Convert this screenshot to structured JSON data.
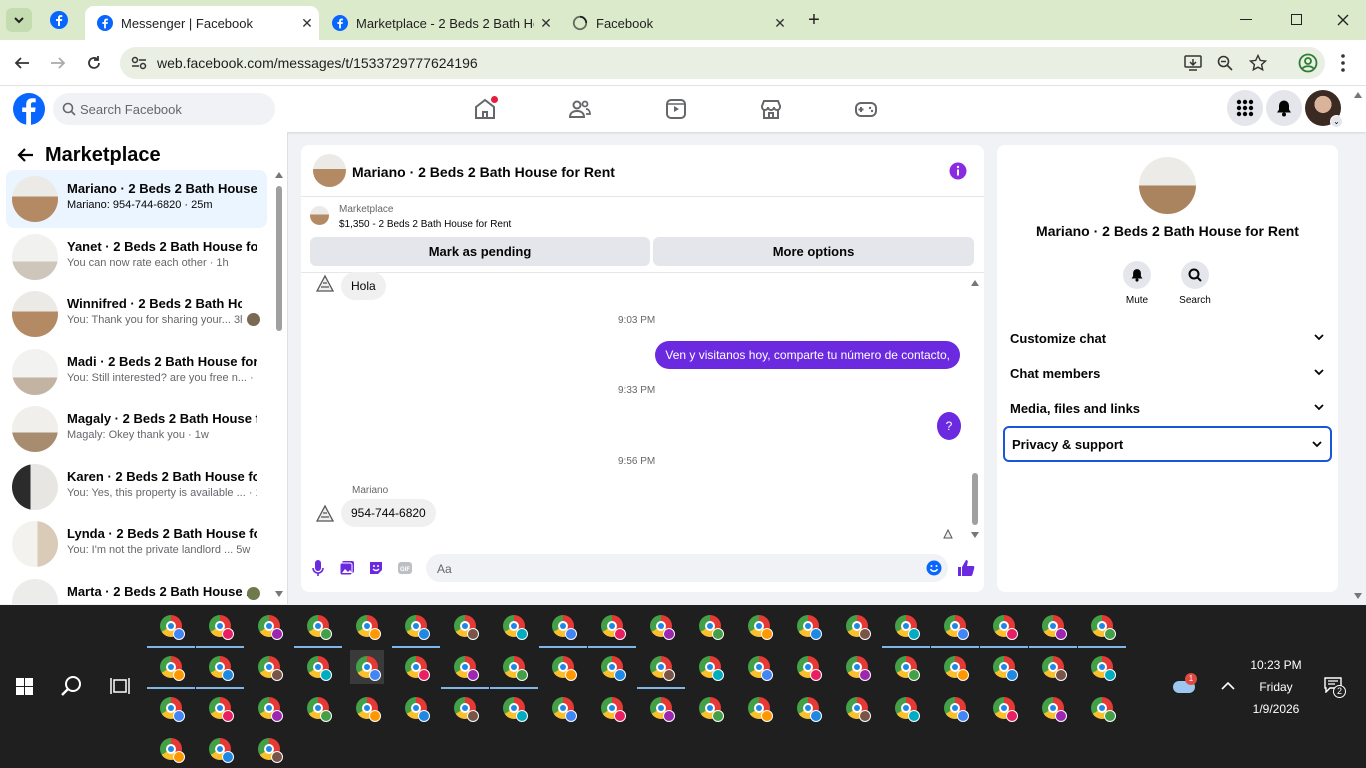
{
  "browser": {
    "tabs": [
      {
        "title": "Messenger | Facebook",
        "close": "✕"
      },
      {
        "title": "Marketplace - 2 Beds 2 Bath Ho",
        "close": "✕"
      },
      {
        "title": "Facebook",
        "close": "✕"
      }
    ],
    "new_tab": "+",
    "url": "web.facebook.com/messages/t/1533729777624196"
  },
  "fb": {
    "search_placeholder": "Search Facebook"
  },
  "sidebar": {
    "title": "Marketplace",
    "conversations": [
      {
        "name": "Mariano · 2 Beds 2 Bath House ...",
        "preview": "Mariano: 954-744-6820 · 25m"
      },
      {
        "name": "Yanet · 2 Beds 2 Bath House for ...",
        "preview": "You can now rate each other · 1h"
      },
      {
        "name": "Winnifred · 2 Beds 2 Bath Ho...",
        "preview": "You: Thank you for sharing your...  3h"
      },
      {
        "name": "Madi · 2 Beds 2 Bath House for ...",
        "preview": "You: Still interested? are you free n... · 1d"
      },
      {
        "name": "Magaly · 2 Beds 2 Bath House f...",
        "preview": "Magaly: Okey thank you · 1w"
      },
      {
        "name": "Karen · 2 Beds 2 Bath House for...",
        "preview": "You: Yes, this property is available ... · 1w"
      },
      {
        "name": "Lynda · 2 Beds 2 Bath House for...",
        "preview": "You: I'm not the private landlord ...  5w"
      },
      {
        "name": "Marta · 2 Beds 2 Bath House ...",
        "preview": ""
      }
    ]
  },
  "chat": {
    "header_title": "Mariano · 2 Beds 2 Bath House for Rent",
    "listing_label": "Marketplace",
    "listing_detail": "$1,350 - 2 Beds 2 Bath House for Rent",
    "mark_pending": "Mark as pending",
    "more_options": "More options",
    "messages": {
      "hola": "Hola",
      "ts1": "9:03 PM",
      "out1": "Ven y visitanos hoy, comparte tu número de contacto,",
      "ts2": "9:33 PM",
      "out2": "?",
      "ts3": "9:56 PM",
      "sender": "Mariano",
      "in2": "954-744-6820"
    },
    "composer_placeholder": "Aa"
  },
  "details": {
    "title": "Mariano · 2 Beds 2 Bath House for Rent",
    "mute": "Mute",
    "search": "Search",
    "sections": [
      "Customize chat",
      "Chat members",
      "Media, files and links",
      "Privacy & support"
    ]
  },
  "taskbar": {
    "time": "10:23 PM",
    "day": "Friday",
    "date": "1/9/2026",
    "notif_count": "2",
    "weather_badge": "1"
  },
  "colors": {
    "fb_blue": "#0866ff",
    "messenger_purple": "#6b2ae0",
    "tab_strip": "#dbeacb",
    "taskbar": "#1f1f1f"
  }
}
